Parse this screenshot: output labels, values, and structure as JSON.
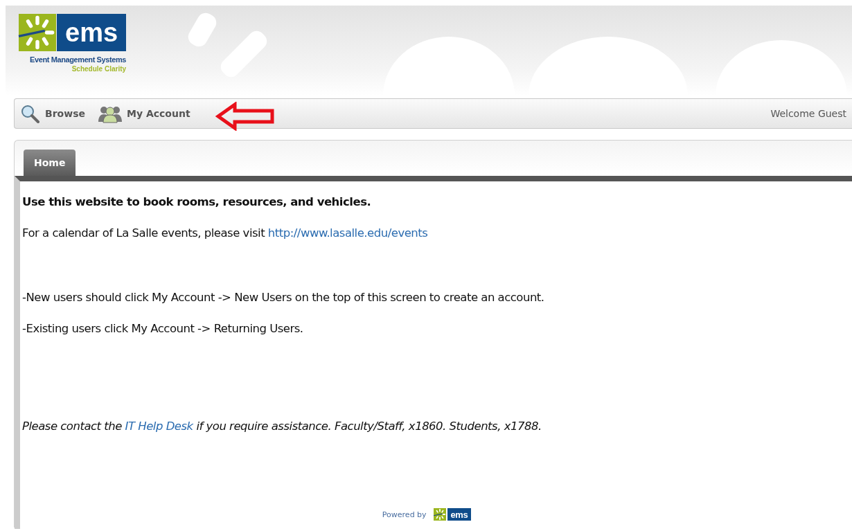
{
  "header": {
    "logo": {
      "mark": "ems",
      "name": "Event Management Systems",
      "tagline": "Schedule Clarity"
    }
  },
  "nav": {
    "items": [
      {
        "label": "Browse",
        "kind": "search"
      },
      {
        "label": "My Account",
        "kind": "people"
      }
    ],
    "welcome": "Welcome Guest"
  },
  "annotation": {
    "kind": "arrow",
    "color": "#e8101a"
  },
  "tabs": [
    {
      "label": "Home",
      "selected": true
    }
  ],
  "content": [
    {
      "kind": "bold",
      "text": "Use this website to book rooms, resources, and vehicles."
    },
    {
      "kind": "link-line",
      "text": "For a calendar of La Salle events, please visit ",
      "link": "http://www.lasalle.edu/events"
    },
    {
      "kind": "gap"
    },
    {
      "kind": "plain",
      "text": "-New users should click My Account -> New Users on the top of this screen to create an account."
    },
    {
      "kind": "plain",
      "text": "-Existing users click My Account -> Returning Users."
    },
    {
      "kind": "gap"
    },
    {
      "kind": "gap"
    },
    {
      "kind": "italic-link-line",
      "text": "Please contact the ",
      "link": "IT Help Desk",
      "after": " if you require assistance.  Faculty/Staff, x1860.  Students, x1788."
    }
  ],
  "footer": {
    "powered_by": "Powered by",
    "logo_mark": "ems"
  }
}
